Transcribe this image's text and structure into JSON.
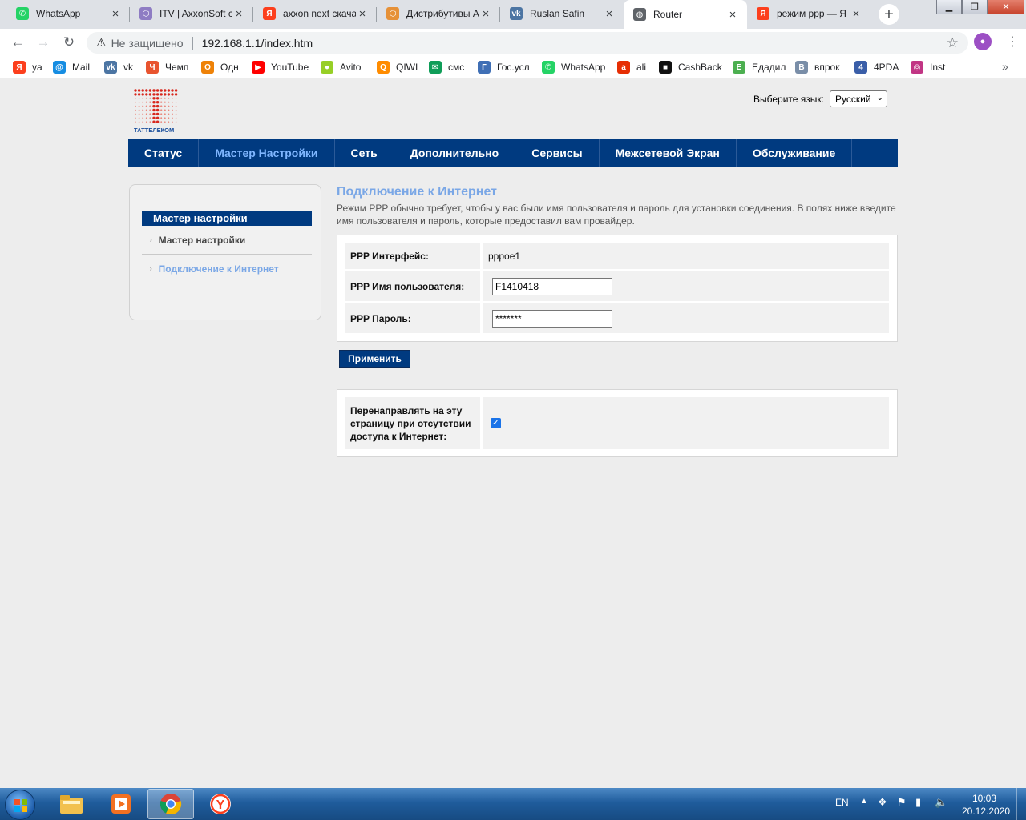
{
  "browser": {
    "tabs": [
      {
        "label": "WhatsApp",
        "icon": "whatsapp-icon",
        "color": "#25d366",
        "glyph": "✆"
      },
      {
        "label": "ITV | AxxonSoft c",
        "icon": "hexagon-icon",
        "color": "#8e7cc3",
        "glyph": "⬡"
      },
      {
        "label": "axxon next скача",
        "icon": "yandex-icon",
        "color": "#fc3f1d",
        "glyph": "Я"
      },
      {
        "label": "Дистрибутивы А",
        "icon": "hexagon-icon",
        "color": "#e69138",
        "glyph": "⬡"
      },
      {
        "label": "Ruslan Safin",
        "icon": "vk-icon",
        "color": "#4c75a3",
        "glyph": "vk"
      },
      {
        "label": "Router",
        "icon": "globe-icon",
        "color": "#5f6368",
        "glyph": "◍"
      },
      {
        "label": "режим ppp — Я",
        "icon": "yandex-icon",
        "color": "#fc3f1d",
        "glyph": "Я"
      }
    ],
    "active_tab": 5,
    "insecure_label": "Не защищено",
    "url": "192.168.1.1/index.htm",
    "profile_glyph": "●",
    "bookmarks": [
      {
        "label": "ya",
        "color": "#fc3f1d",
        "glyph": "Я"
      },
      {
        "label": "Mail",
        "color": "#168de2",
        "glyph": "@"
      },
      {
        "label": "vk",
        "color": "#4c75a3",
        "glyph": "vk"
      },
      {
        "label": "Чемп",
        "color": "#e8542f",
        "glyph": "Ч"
      },
      {
        "label": "Одн",
        "color": "#ee8208",
        "glyph": "О"
      },
      {
        "label": "YouTube",
        "color": "#ff0000",
        "glyph": "▶"
      },
      {
        "label": "Avito",
        "color": "#97cf26",
        "glyph": "●"
      },
      {
        "label": "QIWI",
        "color": "#ff8c00",
        "glyph": "Q"
      },
      {
        "label": "смс",
        "color": "#0f9d58",
        "glyph": "✉"
      },
      {
        "label": "Гос.усл",
        "color": "#3f6fb5",
        "glyph": "Г"
      },
      {
        "label": "WhatsApp",
        "color": "#25d366",
        "glyph": "✆"
      },
      {
        "label": "ali",
        "color": "#e62e04",
        "glyph": "a"
      },
      {
        "label": "CashBack",
        "color": "#111111",
        "glyph": "■"
      },
      {
        "label": "Едадил",
        "color": "#4caf50",
        "glyph": "Е"
      },
      {
        "label": "впрок",
        "color": "#7a8ea8",
        "glyph": "В"
      },
      {
        "label": "4PDA",
        "color": "#3a5ea8",
        "glyph": "4"
      },
      {
        "label": "Inst",
        "color": "#c13584",
        "glyph": "◎"
      }
    ]
  },
  "router": {
    "brand_color": "#003a80",
    "logo_text": "ТАТТЕЛЕКОМ",
    "language": {
      "label": "Выберите язык:",
      "selected": "Русский"
    },
    "nav": [
      {
        "label": "Статус",
        "active": false
      },
      {
        "label": "Мастер Настройки",
        "active": true
      },
      {
        "label": "Сеть",
        "active": false
      },
      {
        "label": "Дополнительно",
        "active": false
      },
      {
        "label": "Сервисы",
        "active": false
      },
      {
        "label": "Межсетевой Экран",
        "active": false
      },
      {
        "label": "Обслуживание",
        "active": false
      }
    ],
    "sidebar": {
      "title": "Мастер настройки",
      "items": [
        {
          "label": "Мастер настройки",
          "current": false
        },
        {
          "label": "Подключение к Интернет",
          "current": true
        }
      ]
    },
    "page": {
      "title": "Подключение к Интернет",
      "description": "Режим PPP обычно требует, чтобы у вас были имя пользователя и пароль для установки соединения. В полях ниже введите имя пользователя и пароль, которые предоставил вам провайдер.",
      "fields": {
        "interface": {
          "label": "PPP Интерфейс:",
          "value": "pppoe1"
        },
        "username": {
          "label": "PPP Имя пользователя:",
          "value": "F1410418"
        },
        "password": {
          "label": "PPP Пароль:",
          "value": "*******"
        }
      },
      "apply_label": "Применить",
      "redirect": {
        "label": "Перенаправлять на эту страницу при отсутствии доступа к Интернет:",
        "checked": true
      }
    }
  },
  "taskbar": {
    "language": "EN",
    "time": "10:03",
    "date": "20.12.2020"
  }
}
